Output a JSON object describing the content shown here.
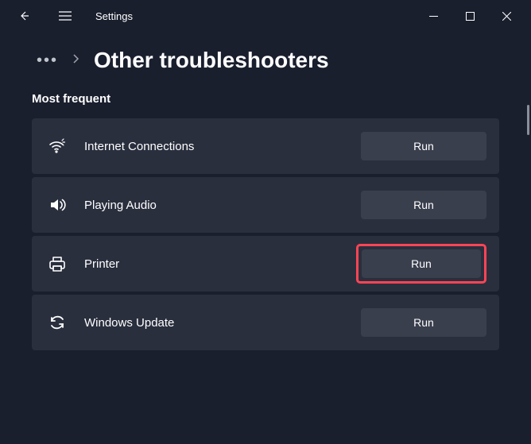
{
  "app": {
    "title": "Settings"
  },
  "breadcrumb": {
    "heading": "Other troubleshooters"
  },
  "section": {
    "title": "Most frequent"
  },
  "items": [
    {
      "icon": "wifi",
      "label": "Internet Connections",
      "action": "Run",
      "highlighted": false
    },
    {
      "icon": "audio",
      "label": "Playing Audio",
      "action": "Run",
      "highlighted": false
    },
    {
      "icon": "printer",
      "label": "Printer",
      "action": "Run",
      "highlighted": true
    },
    {
      "icon": "update",
      "label": "Windows Update",
      "action": "Run",
      "highlighted": false
    }
  ]
}
